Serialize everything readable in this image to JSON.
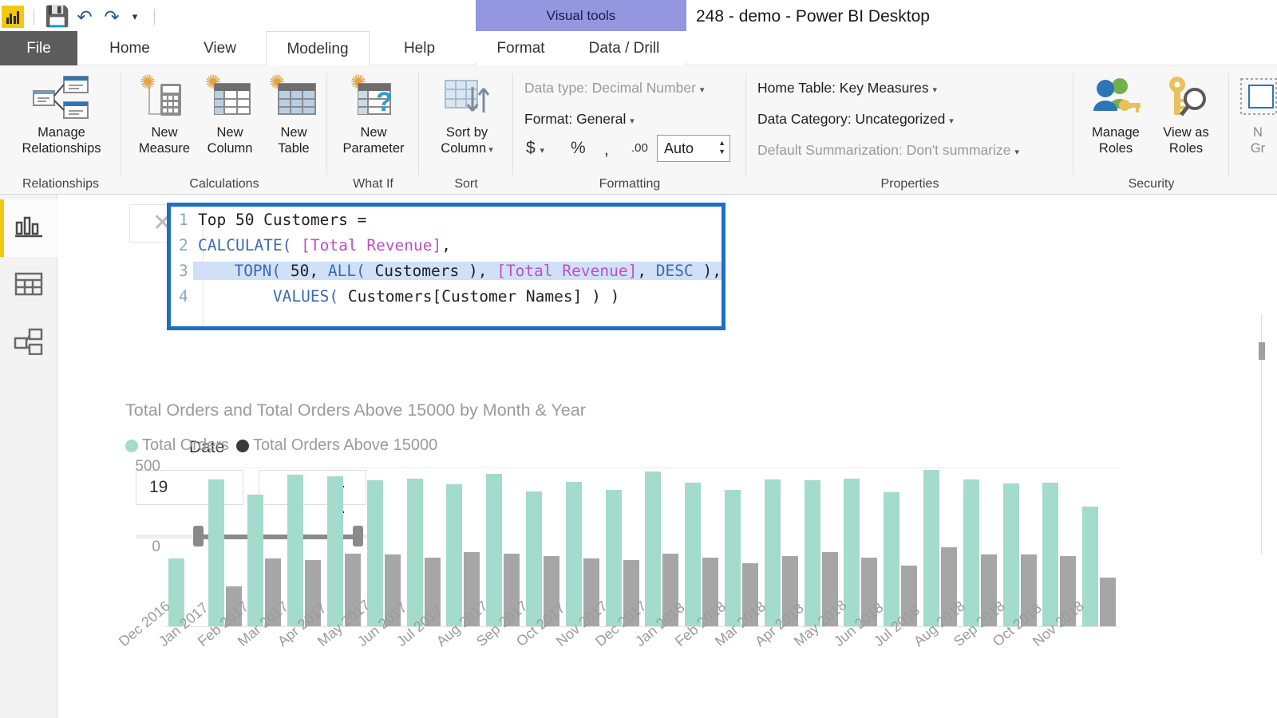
{
  "window": {
    "title": "248 - demo - Power BI Desktop",
    "contextual_tab_header": "Visual tools"
  },
  "quick_access": {
    "logo": "powerbi-logo",
    "save": "save-icon",
    "undo": "undo-icon",
    "redo": "redo-icon",
    "customize": "customize-qat-icon"
  },
  "tabs": [
    {
      "label": "File",
      "active": false
    },
    {
      "label": "Home",
      "active": false
    },
    {
      "label": "View",
      "active": false
    },
    {
      "label": "Modeling",
      "active": true
    },
    {
      "label": "Help",
      "active": false
    },
    {
      "label": "Format",
      "active": false
    },
    {
      "label": "Data / Drill",
      "active": false
    }
  ],
  "ribbon": {
    "groups": [
      {
        "name": "Relationships",
        "label": "Relationships"
      },
      {
        "name": "Calculations",
        "label": "Calculations"
      },
      {
        "name": "WhatIf",
        "label": "What If"
      },
      {
        "name": "Sort",
        "label": "Sort"
      },
      {
        "name": "Formatting",
        "label": "Formatting"
      },
      {
        "name": "Properties",
        "label": "Properties"
      },
      {
        "name": "Security",
        "label": "Security"
      }
    ],
    "manage_relationships": {
      "line1": "Manage",
      "line2": "Relationships"
    },
    "new_measure": {
      "line1": "New",
      "line2": "Measure"
    },
    "new_column": {
      "line1": "New",
      "line2": "Column"
    },
    "new_table": {
      "line1": "New",
      "line2": "Table"
    },
    "new_parameter": {
      "line1": "New",
      "line2": "Parameter"
    },
    "sort_by_column": {
      "line1": "Sort by",
      "line2": "Column"
    },
    "data_type": "Data type: Decimal Number",
    "format": "Format: General",
    "currency_btn": "$",
    "percent_btn": "%",
    "comma_btn": ",",
    "decimal_btn": ".00",
    "decimal_places_value": "Auto",
    "home_table": "Home Table: Key Measures",
    "data_category": "Data Category: Uncategorized",
    "default_summarization": "Default Summarization: Don't summarize",
    "manage_roles": {
      "line1": "Manage",
      "line2": "Roles"
    },
    "view_as_roles": {
      "line1": "View as",
      "line2": "Roles"
    },
    "new_group_clipped": {
      "line1": "N",
      "line2": "Gr"
    }
  },
  "left_nav": [
    {
      "name": "report-view",
      "icon": "bar-chart-icon",
      "selected": true
    },
    {
      "name": "data-view",
      "icon": "table-icon",
      "selected": false
    },
    {
      "name": "model-view",
      "icon": "model-relationships-icon",
      "selected": false
    }
  ],
  "formula_bar": {
    "cancel_icon": "close-icon",
    "commit_icon": "checkmark-icon",
    "lines": [
      {
        "num": "1",
        "selected": false,
        "tokens": [
          {
            "t": "Top 50 Customers =",
            "c": "n"
          }
        ]
      },
      {
        "num": "2",
        "selected": false,
        "tokens": [
          {
            "t": "CALCULATE(",
            "c": "k"
          },
          {
            "t": " ",
            "c": "p"
          },
          {
            "t": "[Total Revenue]",
            "c": "m"
          },
          {
            "t": ",",
            "c": "p"
          }
        ]
      },
      {
        "num": "3",
        "selected": true,
        "tokens": [
          {
            "t": "    ",
            "c": "p"
          },
          {
            "t": "TOPN(",
            "c": "k"
          },
          {
            "t": " 50, ",
            "c": "n"
          },
          {
            "t": "ALL(",
            "c": "k"
          },
          {
            "t": " Customers ), ",
            "c": "n"
          },
          {
            "t": "[Total Revenue]",
            "c": "m"
          },
          {
            "t": ", ",
            "c": "n"
          },
          {
            "t": "DESC",
            "c": "k"
          },
          {
            "t": " ),",
            "c": "n"
          }
        ]
      },
      {
        "num": "4",
        "selected": false,
        "tokens": [
          {
            "t": "        ",
            "c": "p"
          },
          {
            "t": "VALUES(",
            "c": "k"
          },
          {
            "t": " Customers[Customer Names] ) )",
            "c": "n"
          }
        ]
      }
    ]
  },
  "slicer": {
    "label": "Date",
    "value": "19",
    "name": "date-range-slicer"
  },
  "chart_data": {
    "type": "bar",
    "title": "Total Orders and Total Orders Above 15000 by Month & Year",
    "xlabel": "",
    "ylabel": "",
    "ylim": [
      0,
      800
    ],
    "yticks": [
      "0",
      "500"
    ],
    "grid": true,
    "legend_position": "top-left",
    "colors": {
      "Total Orders": "#A3DBCD",
      "Total Orders Above 15000": "#A6A6A6"
    },
    "categories": [
      "Dec 2016",
      "Jan 2017",
      "Feb 2017",
      "Mar 2017",
      "Apr 2017",
      "May 2017",
      "Jun 2017",
      "Jul 2017",
      "Aug 2017",
      "Sep 2017",
      "Oct 2017",
      "Nov 2017",
      "Dec 2017",
      "Jan 2018",
      "Feb 2018",
      "Mar 2018",
      "Apr 2018",
      "May 2018",
      "Jun 2018",
      "Jul 2018",
      "Aug 2018",
      "Sep 2018",
      "Oct 2018",
      "Nov 2018"
    ],
    "series": [
      {
        "name": "Total Orders",
        "values": [
          345,
          740,
          665,
          765,
          755,
          735,
          745,
          715,
          770,
          680,
          730,
          690,
          780,
          725,
          690,
          740,
          735,
          745,
          675,
          790,
          740,
          720,
          725,
          605
        ]
      },
      {
        "name": "Total Orders Above 15000",
        "values": [
          0,
          205,
          345,
          335,
          370,
          365,
          350,
          375,
          370,
          355,
          345,
          335,
          370,
          350,
          320,
          355,
          375,
          350,
          310,
          400,
          365,
          365,
          355,
          250
        ]
      }
    ]
  },
  "scrollbar": {
    "name": "vertical-scrollbar"
  }
}
